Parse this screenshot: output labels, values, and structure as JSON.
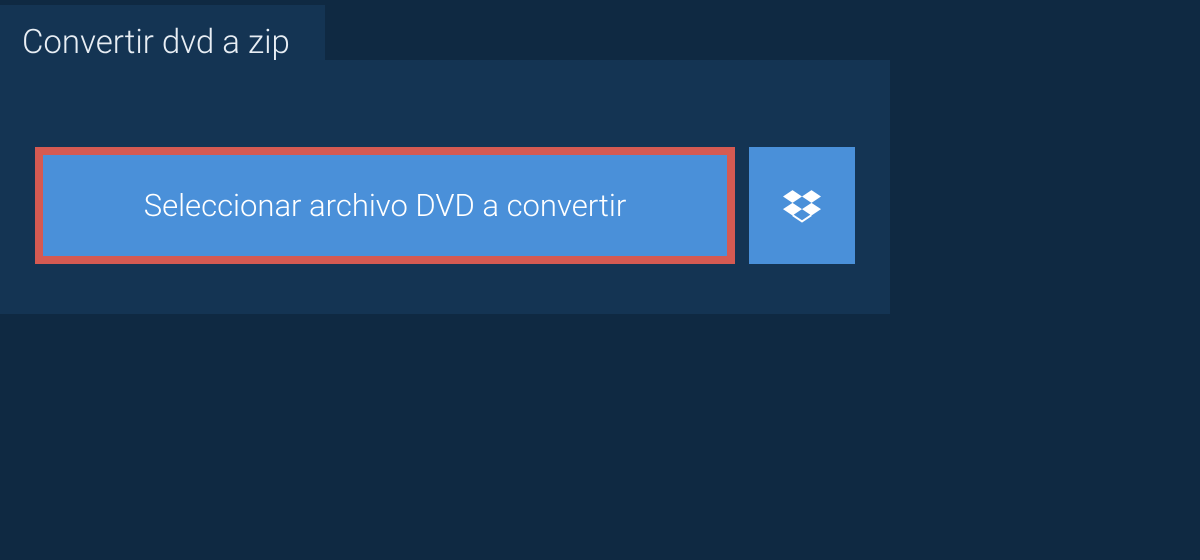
{
  "tab": {
    "title": "Convertir dvd a zip"
  },
  "actions": {
    "select_file_label": "Seleccionar archivo DVD a convertir"
  }
}
